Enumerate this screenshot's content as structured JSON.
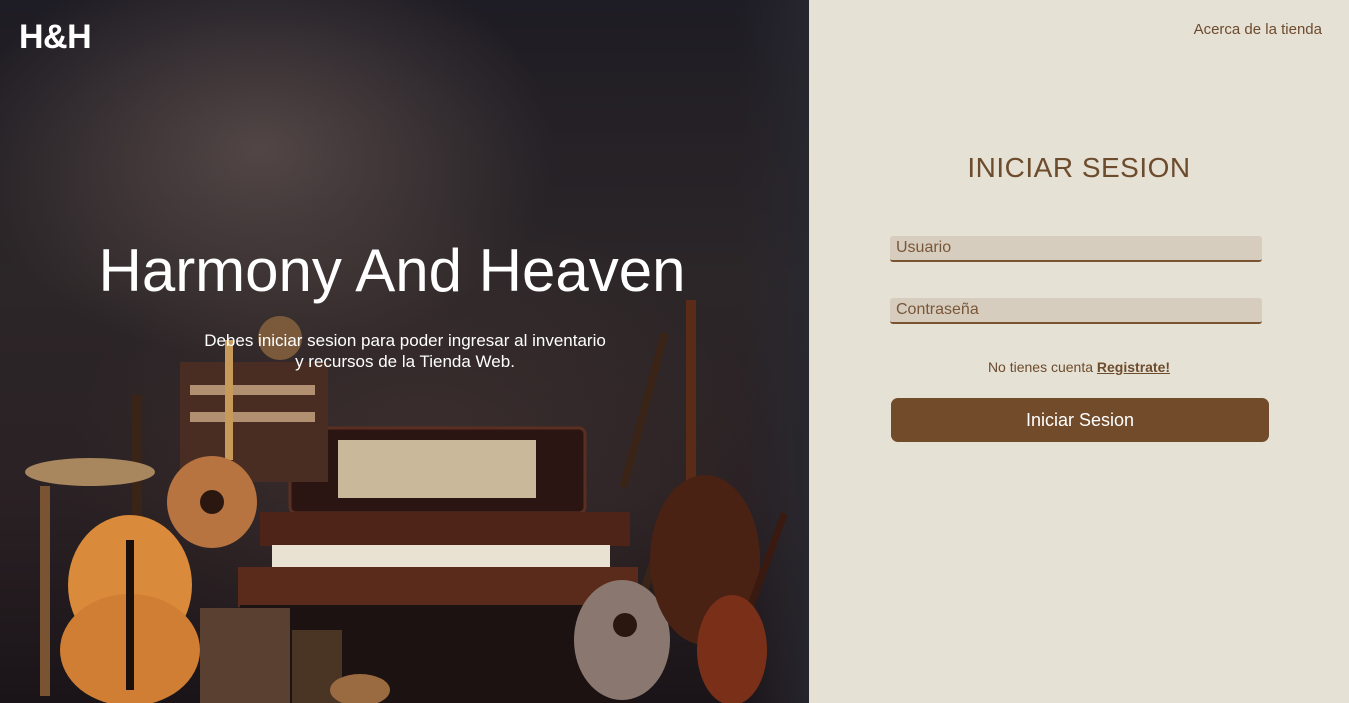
{
  "brand": {
    "logo": "H&H"
  },
  "hero": {
    "title": "Harmony And Heaven",
    "subtitle_line1": "Debes iniciar sesion para poder ingresar al inventario",
    "subtitle_line2": "y recursos de la Tienda Web."
  },
  "nav": {
    "about_label": "Acerca de la tienda"
  },
  "login": {
    "title": "INICIAR SESION",
    "username_placeholder": "Usuario",
    "password_placeholder": "Contraseña",
    "register_prompt": "No tienes cuenta",
    "register_link": "Registrate!",
    "submit_label": "Iniciar Sesion"
  },
  "colors": {
    "accent": "#714b2a",
    "panel_bg": "#e6e1d5",
    "input_bg": "#d7cdbf",
    "text_brown": "#6d4b2d"
  }
}
